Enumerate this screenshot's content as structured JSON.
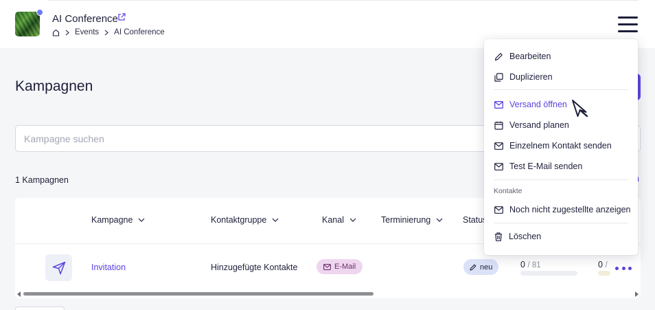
{
  "header": {
    "event_title": "AI Conference",
    "breadcrumb": [
      "Events",
      "AI Conference"
    ]
  },
  "page": {
    "title": "Kampagnen",
    "search_placeholder": "Kampagne suchen",
    "count_label": "1 Kampagnen"
  },
  "table": {
    "columns": [
      "Kampagne",
      "Kontaktgruppe",
      "Kanal",
      "Terminierung",
      "Status"
    ],
    "rows": [
      {
        "name": "Invitation",
        "contact_group": "Hinzugefügte Kontakte",
        "channel": "E-Mail",
        "status": "neu",
        "progress_1": {
          "done": "0",
          "total": "/ 81",
          "fraction": 0
        },
        "progress_2": {
          "done": "0",
          "total": "/",
          "fraction": 0
        }
      }
    ]
  },
  "menu": {
    "items": [
      {
        "label": "Bearbeiten",
        "icon": "pencil-icon"
      },
      {
        "label": "Duplizieren",
        "icon": "duplicate-icon"
      },
      {
        "label": "Versand öffnen",
        "icon": "envelope-icon",
        "active": true
      },
      {
        "label": "Versand planen",
        "icon": "calendar-icon"
      },
      {
        "label": "Einzelnem Kontakt senden",
        "icon": "envelope-icon"
      },
      {
        "label": "Test E-Mail senden",
        "icon": "envelope-icon"
      },
      {
        "label": "Noch nicht zugestellte anzeigen",
        "icon": "envelope-icon"
      },
      {
        "label": "Löschen",
        "icon": "trash-icon"
      }
    ],
    "section_label": "Kontakte"
  },
  "colors": {
    "accent": "#5b43e0",
    "text": "#1d1f3a",
    "background": "#f5f6f8",
    "email_badge_bg": "#efd6ef",
    "new_badge_bg": "#dbe1f7"
  }
}
